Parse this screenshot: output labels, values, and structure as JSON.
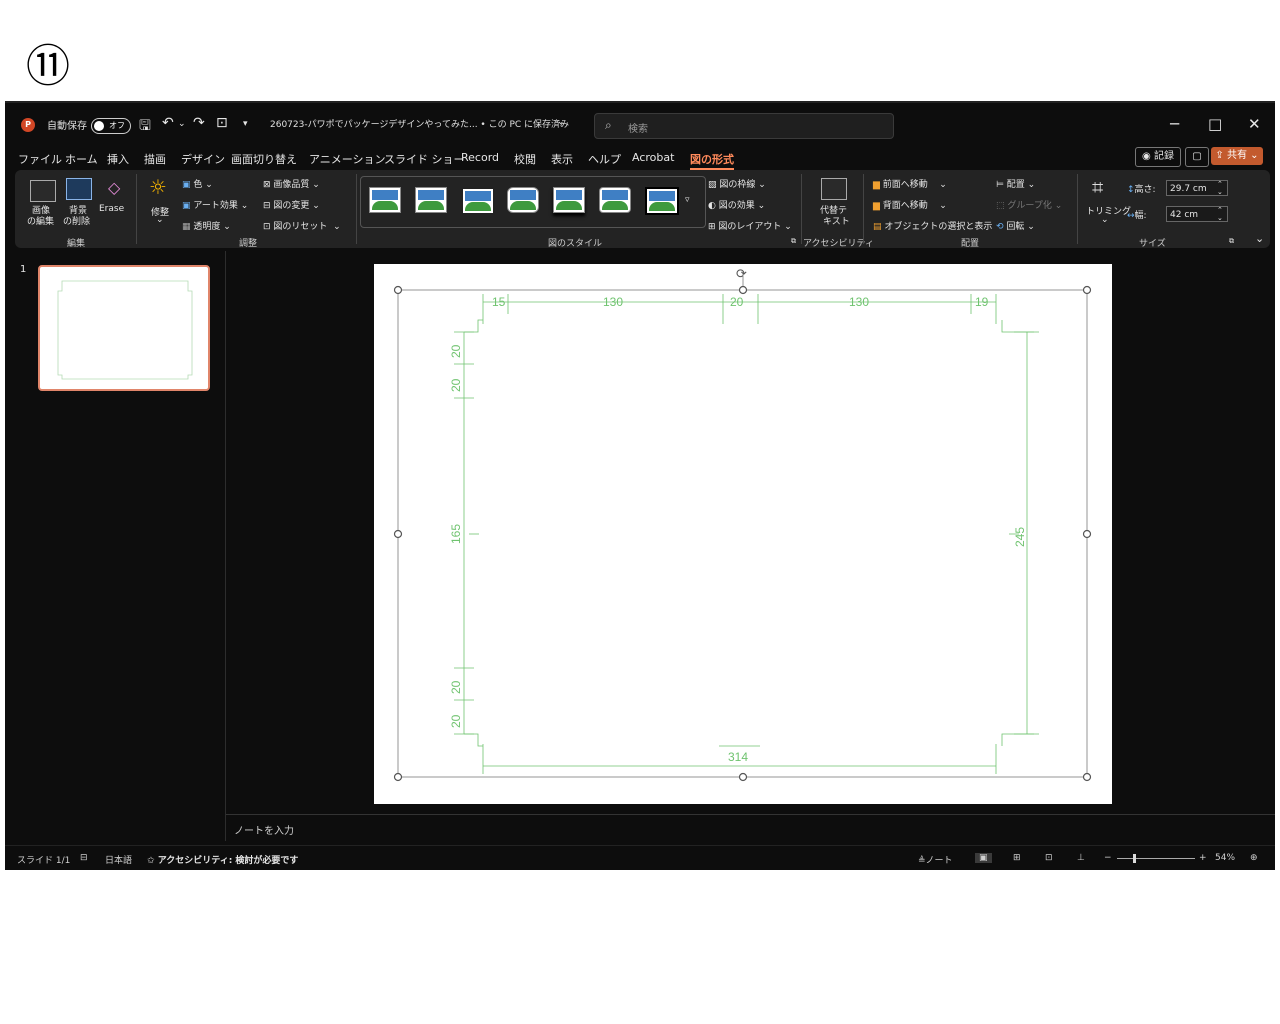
{
  "step_marker": "⑪",
  "titlebar": {
    "app_icon_letter": "P",
    "autosave_label": "自動保存",
    "autosave_state": "オフ",
    "document_title": "260723-パワポでパッケージデザインやってみた... • この PC に保存済み",
    "search_placeholder": "検索",
    "minimize": "─",
    "maximize": "□",
    "close": "✕"
  },
  "menu": {
    "items": [
      "ファイル",
      "ホーム",
      "挿入",
      "描画",
      "デザイン",
      "画面切り替え",
      "アニメーション",
      "スライド ショー",
      "Record",
      "校閲",
      "表示",
      "ヘルプ",
      "Acrobat",
      "図の形式"
    ],
    "active_index": 13,
    "record_button": "記録",
    "share_button": "共有"
  },
  "ribbon": {
    "edit_group": {
      "edit_image": "画像\nの編集",
      "remove_bg_line1": "背景",
      "remove_bg_line2": "の削除",
      "erase": "Erase",
      "group_label": "編集",
      "edit_line1": "画像",
      "edit_line2": "の編集"
    },
    "adjust_group": {
      "corrections": "修整",
      "color": "色",
      "artistic": "アート効果",
      "transparency": "透明度",
      "compress": "画像品質",
      "change": "図の変更",
      "reset": "図のリセット",
      "group_label": "調整"
    },
    "styles_group": {
      "group_label": "図のスタイル",
      "border": "図の枠線",
      "effects": "図の効果",
      "layout": "図のレイアウト"
    },
    "access_group": {
      "alt_text_line1": "代替テ",
      "alt_text_line2": "キスト",
      "group_label": "アクセシビリティ"
    },
    "arrange_group": {
      "bring_forward": "前面へ移動",
      "send_backward": "背面へ移動",
      "selection_pane": "オブジェクトの選択と表示",
      "align": "配置",
      "group": "グループ化",
      "rotate": "回転",
      "group_label": "配置"
    },
    "size_group": {
      "crop": "トリミング",
      "height_label": "高さ:",
      "height_value": "29.7 cm",
      "width_label": "幅:",
      "width_value": "42 cm",
      "group_label": "サイズ"
    }
  },
  "thumbnails": [
    {
      "number": "1"
    }
  ],
  "drawing": {
    "top_dims": [
      "15",
      "130",
      "20",
      "130",
      "19"
    ],
    "left_dims": [
      "20",
      "20",
      "165",
      "20",
      "20"
    ],
    "right_dim": "245",
    "bottom_dim": "314",
    "line_color": "#6fc36f"
  },
  "notes_placeholder": "ノートを入力",
  "statusbar": {
    "slide_info": "スライド 1/1",
    "language": "日本語",
    "accessibility": "アクセシビリティ: 検討が必要です",
    "notes_button": "ノート",
    "zoom": "54%"
  }
}
